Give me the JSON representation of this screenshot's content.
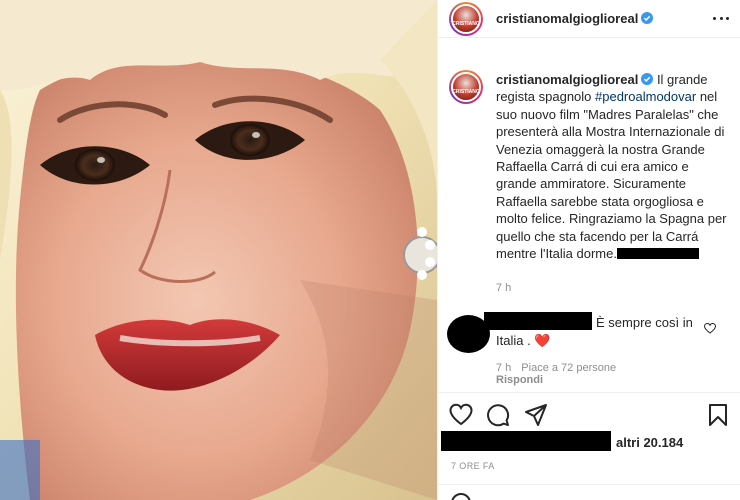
{
  "post": {
    "username": "cristianomalgioglioreal",
    "avatar_label": "CRISTIANO",
    "caption_intro": " Il grande regista spagnolo ",
    "hashtag": "#pedroalmodovar",
    "caption_body": " nel suo nuovo film \"Madres Paralelas\" che presenterà alla Mostra Internazionale di Venezia omaggerà la nostra Grande Raffaella Carrá di cui era amico e grande ammiratore. Sicuramente Raffaella sarebbe stata orgogliosa e molto felice. Ringraziamo la Spagna per quello che sta facendo per la Carrá mentre l'Italia dorme.",
    "caption_time": "7 h"
  },
  "comment": {
    "text_line1": "È sempre così in",
    "text_line2": "Italia .",
    "heart_emoji": "❤️",
    "time": "7 h",
    "likes": "Piace a 72 persone",
    "reply": "Rispondi"
  },
  "likes": {
    "others": "altri 20.184"
  },
  "timestamp": "7 ORE FA",
  "colors": {
    "link": "#00376b",
    "verified": "#3897f0",
    "secondary_text": "#8e8e8e",
    "heart": "#ed4956"
  },
  "icons": [
    "more-icon",
    "verified-icon",
    "heart-outline-icon",
    "like-icon",
    "comment-icon",
    "share-icon",
    "save-icon"
  ]
}
